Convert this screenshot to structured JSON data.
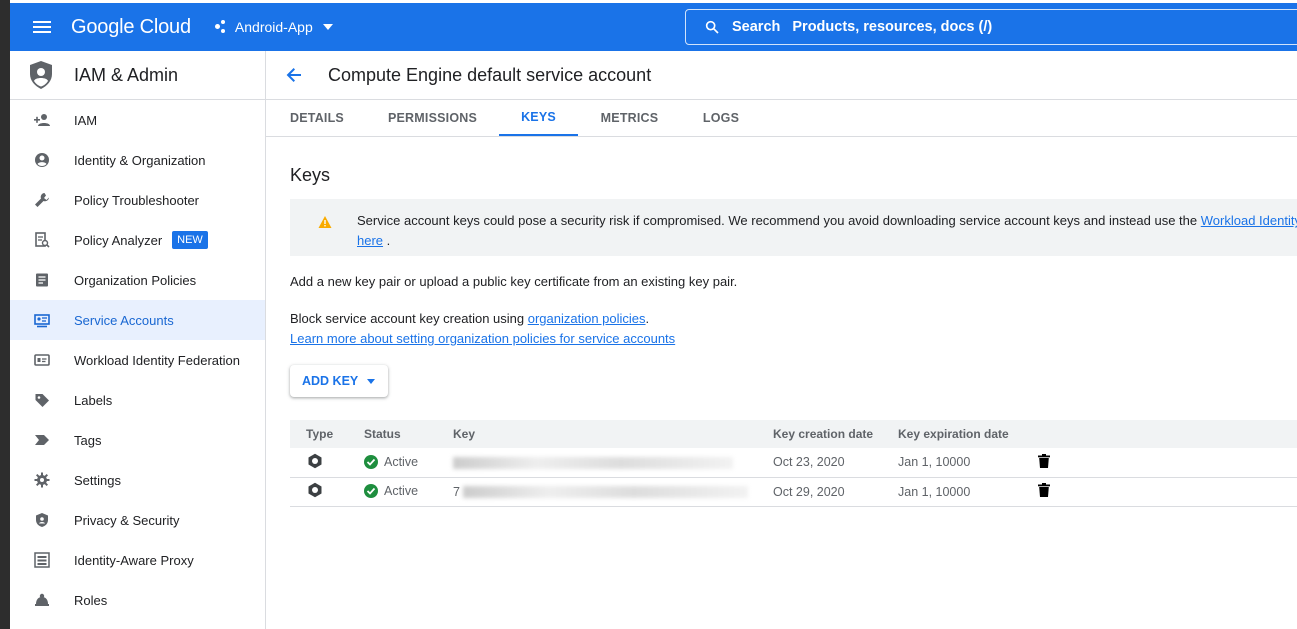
{
  "topbar": {
    "logo": "Google Cloud",
    "project": "Android-App",
    "search_label": "Search",
    "search_placeholder": "Products, resources, docs (/)"
  },
  "sidebar": {
    "title": "IAM & Admin",
    "items": [
      {
        "label": "IAM",
        "icon": "person-add-icon"
      },
      {
        "label": "Identity & Organization",
        "icon": "account-circle-icon"
      },
      {
        "label": "Policy Troubleshooter",
        "icon": "wrench-icon"
      },
      {
        "label": "Policy Analyzer",
        "icon": "policy-analyzer-icon",
        "badge": "NEW"
      },
      {
        "label": "Organization Policies",
        "icon": "document-icon"
      },
      {
        "label": "Service Accounts",
        "icon": "service-account-icon",
        "active": true
      },
      {
        "label": "Workload Identity Federation",
        "icon": "id-card-icon"
      },
      {
        "label": "Labels",
        "icon": "label-icon"
      },
      {
        "label": "Tags",
        "icon": "tag-icon"
      },
      {
        "label": "Settings",
        "icon": "gear-icon"
      },
      {
        "label": "Privacy & Security",
        "icon": "shield-icon"
      },
      {
        "label": "Identity-Aware Proxy",
        "icon": "proxy-icon"
      },
      {
        "label": "Roles",
        "icon": "roles-icon"
      }
    ]
  },
  "page": {
    "title": "Compute Engine default service account",
    "tabs": [
      "DETAILS",
      "PERMISSIONS",
      "KEYS",
      "METRICS",
      "LOGS"
    ],
    "active_tab": "KEYS",
    "section_title": "Keys",
    "warning_text": "Service account keys could pose a security risk if compromised. We recommend you avoid downloading service account keys and instead use the ",
    "warning_link": "Workload Identity",
    "warning_link2": "here",
    "warning_end": " .",
    "add_text": "Add a new key pair or upload a public key certificate from an existing key pair.",
    "block_text": "Block service account key creation using ",
    "block_link": "organization policies",
    "block_end": ".",
    "learn_link": "Learn more about setting organization policies for service accounts",
    "add_key_button": "ADD KEY"
  },
  "table": {
    "headers": [
      "Type",
      "Status",
      "Key",
      "Key creation date",
      "Key expiration date"
    ],
    "rows": [
      {
        "status": "Active",
        "key_visible": "",
        "created": "Oct 23, 2020",
        "expires": "Jan 1, 10000"
      },
      {
        "status": "Active",
        "key_visible": "7",
        "created": "Oct 29, 2020",
        "expires": "Jan 1, 10000"
      }
    ]
  },
  "colors": {
    "brand_blue": "#1a73e8",
    "active_green": "#1e8e3e"
  }
}
